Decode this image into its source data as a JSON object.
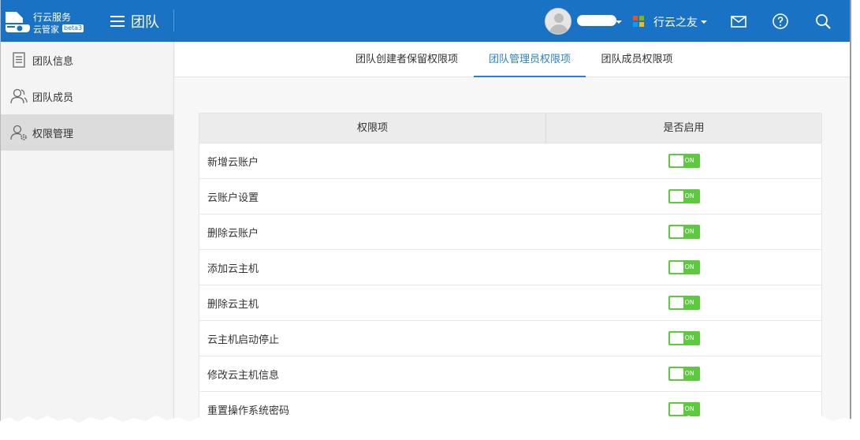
{
  "colors": {
    "header_bg": "#1a72c4",
    "accent": "#2a7fd4",
    "toggle_on": "#5cc93f",
    "sidebar_active": "#dcdcdc"
  },
  "header": {
    "logo_line1": "行云服务",
    "logo_line2": "云管家",
    "logo_badge": "beta3",
    "menu_title": "团队",
    "org_name": "行云之友",
    "icons": [
      "mail-icon",
      "help-icon",
      "search-icon"
    ]
  },
  "sidebar": {
    "items": [
      {
        "label": "团队信息",
        "icon": "document-icon",
        "active": false
      },
      {
        "label": "团队成员",
        "icon": "user-icon",
        "active": false
      },
      {
        "label": "权限管理",
        "icon": "user-gear-icon",
        "active": true
      }
    ]
  },
  "tabs": [
    {
      "label": "团队创建者保留权限项",
      "active": false
    },
    {
      "label": "团队管理员权限项",
      "active": true
    },
    {
      "label": "团队成员权限项",
      "active": false
    }
  ],
  "table": {
    "headers": [
      "权限项",
      "是否启用"
    ],
    "rows": [
      {
        "name": "新增云账户",
        "toggle": "ON"
      },
      {
        "name": "云账户设置",
        "toggle": "ON"
      },
      {
        "name": "删除云账户",
        "toggle": "ON"
      },
      {
        "name": "添加云主机",
        "toggle": "ON"
      },
      {
        "name": "删除云主机",
        "toggle": "ON"
      },
      {
        "name": "云主机启动停止",
        "toggle": "ON"
      },
      {
        "name": "修改云主机信息",
        "toggle": "ON"
      },
      {
        "name": "重置操作系统密码",
        "toggle": "ON"
      }
    ]
  }
}
